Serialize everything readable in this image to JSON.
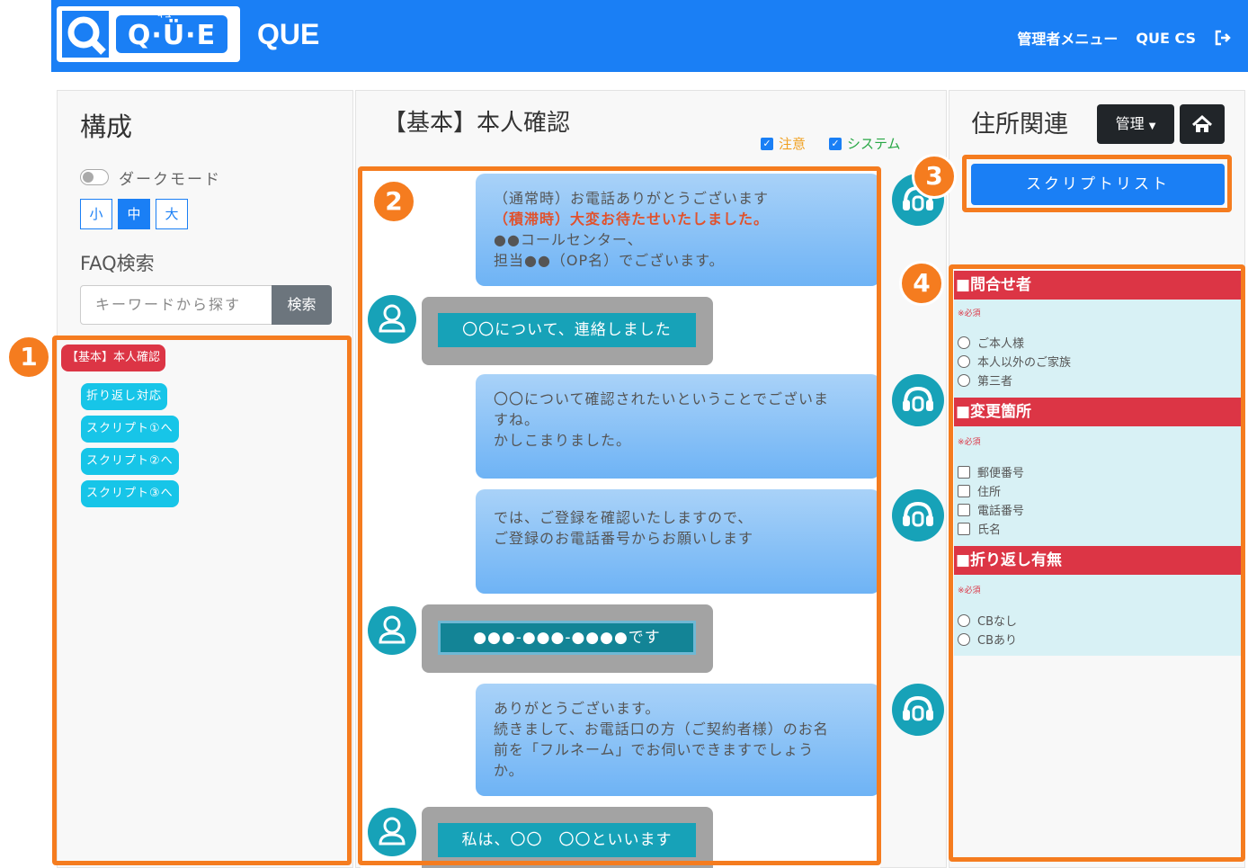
{
  "header": {
    "logo_text": "Q·Ü·E",
    "logo_ruby": "キュー",
    "brand": "QUE",
    "admin_menu": "管理者メニュー",
    "user": "QUE CS"
  },
  "left": {
    "title": "構成",
    "dark_mode_label": "ダークモード",
    "sizes": [
      "小",
      "中",
      "大"
    ],
    "active_size": "中",
    "faq_title": "FAQ検索",
    "search_placeholder": "キーワードから探す",
    "search_button": "検索",
    "current_tag": "【基本】本人確認",
    "links": [
      "折り返し対応",
      "スクリプト①へ",
      "スクリプト②へ",
      "スクリプト③へ"
    ]
  },
  "middle": {
    "title": "【基本】本人確認",
    "filter_caution": "注意",
    "filter_system": "システム",
    "messages": [
      {
        "line1": "（通常時）お電話ありがとうございます",
        "line2": "（積滞時）大変お待たせいたしました。",
        "line3": "●●コールセンター、",
        "line4": "担当●●（OP名）でございます。"
      },
      {
        "text": "〇〇について、連絡しました"
      },
      {
        "line1": "〇〇について確認されたいということでございま",
        "line2": "すね。",
        "line3": "かしこまりました。"
      },
      {
        "line1": "では、ご登録を確認いたしますので、",
        "line2": "ご登録のお電話番号からお願いします"
      },
      {
        "text": "●●●-●●●-●●●●です"
      },
      {
        "line1": "ありがとうございます。",
        "line2": "続きまして、お電話口の方（ご契約者様）のお名",
        "line3": "前を「フルネーム」でお伺いできますでしょう",
        "line4": "か。"
      },
      {
        "text": "私は、〇〇　〇〇といいます"
      }
    ]
  },
  "right": {
    "title": "住所関連",
    "manage_button": "管理",
    "script_list_button": "スクリプトリスト",
    "required": "※必須",
    "sections": [
      {
        "title": "■問合せ者",
        "options": [
          "ご本人様",
          "本人以外のご家族",
          "第三者"
        ]
      },
      {
        "title": "■変更箇所",
        "options": [
          "郵便番号",
          "住所",
          "電話番号",
          "氏名"
        ]
      },
      {
        "title": "■折り返し有無",
        "options": [
          "CBなし",
          "CBあり"
        ]
      }
    ]
  },
  "callouts": [
    "1",
    "2",
    "3",
    "4"
  ],
  "colors": {
    "primary": "#1a7ff5",
    "danger": "#dc3545",
    "info": "#17a2b8",
    "highlight": "#f57c1f"
  }
}
